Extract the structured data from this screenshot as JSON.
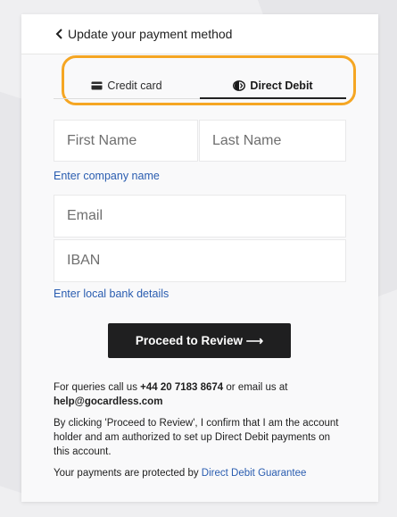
{
  "header": {
    "back_label": "Update your payment method"
  },
  "tabs": [
    {
      "label": "Credit card",
      "icon": "credit-card-icon",
      "selected": false
    },
    {
      "label": "Direct Debit",
      "icon": "direct-debit-icon",
      "selected": true
    }
  ],
  "highlight_color": "#f5a623",
  "form": {
    "first_name_placeholder": "First Name",
    "last_name_placeholder": "Last Name",
    "company_link": "Enter company name",
    "email_placeholder": "Email",
    "iban_placeholder": "IBAN",
    "bank_link": "Enter local bank details",
    "proceed_label": "Proceed to Review ⟶"
  },
  "info": {
    "queries_prefix": "For queries call us ",
    "phone": "+44 20 7183 8674",
    "queries_middle": " or email us at",
    "email": "help@gocardless.com",
    "confirm_text": "By clicking 'Proceed to Review', I confirm that I am the account holder and am authorized to set up Direct Debit payments on this account.",
    "protected_prefix": "Your payments are protected by ",
    "guarantee_link": "Direct Debit Guarantee"
  }
}
